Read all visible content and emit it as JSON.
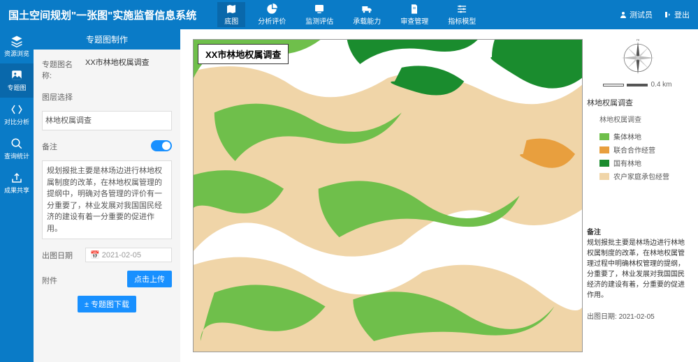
{
  "app_title": "国土空间规划\"一张图\"实施监督信息系统",
  "topnav": [
    {
      "label": "底图",
      "active": true
    },
    {
      "label": "分析评价"
    },
    {
      "label": "监测评估"
    },
    {
      "label": "承载能力"
    },
    {
      "label": "审查管理"
    },
    {
      "label": "指标模型"
    }
  ],
  "user": {
    "name": "测试员",
    "action": "登出"
  },
  "sidebar": [
    {
      "label": "资源浏览"
    },
    {
      "label": "专题图",
      "active": true
    },
    {
      "label": "对比分析"
    },
    {
      "label": "查询统计"
    },
    {
      "label": "成果共享"
    }
  ],
  "panel": {
    "title": "专题图制作",
    "name_label": "专题图名称:",
    "name_value": "XX市林地权属调查",
    "layer_label": "图层选择",
    "layer_value": "林地权属调查",
    "remark_label": "备注",
    "remark_text": "规划报批主要是林场边进行林地权属制度的改革，在林地权属管理的提纲中，明确对各管理的评价有一分重要了，林业发展对我国国民经济的建设有着一分重要的促进作用。",
    "date_label": "出图日期",
    "date_value": "2021-02-05",
    "attach_label": "附件",
    "attach_btn": "点击上传",
    "download_btn": "± 专题图下载"
  },
  "map": {
    "title": "XX市林地权属调查",
    "scale_label": "0.4 km",
    "legend_title": "林地权属调查",
    "legend_sub": "林地权属调查",
    "legend_items": [
      {
        "color": "#6fbf4b",
        "label": "集体林地"
      },
      {
        "color": "#e89f3e",
        "label": "联合合作经营"
      },
      {
        "color": "#1a8c2e",
        "label": "国有林地"
      },
      {
        "color": "#f0d5a8",
        "label": "农户家庭承包经营"
      }
    ],
    "remark_title": "备注",
    "remark_text": "规划报批主要是林场边进行林地权属制度的改革，在林地权属管理过程中明确林权管理的提纲，分重要了，林业发展对我国国民经济的建设有着，分重要的促进作用。",
    "remark_date_label": "出图日期:",
    "remark_date": "2021-02-05"
  }
}
